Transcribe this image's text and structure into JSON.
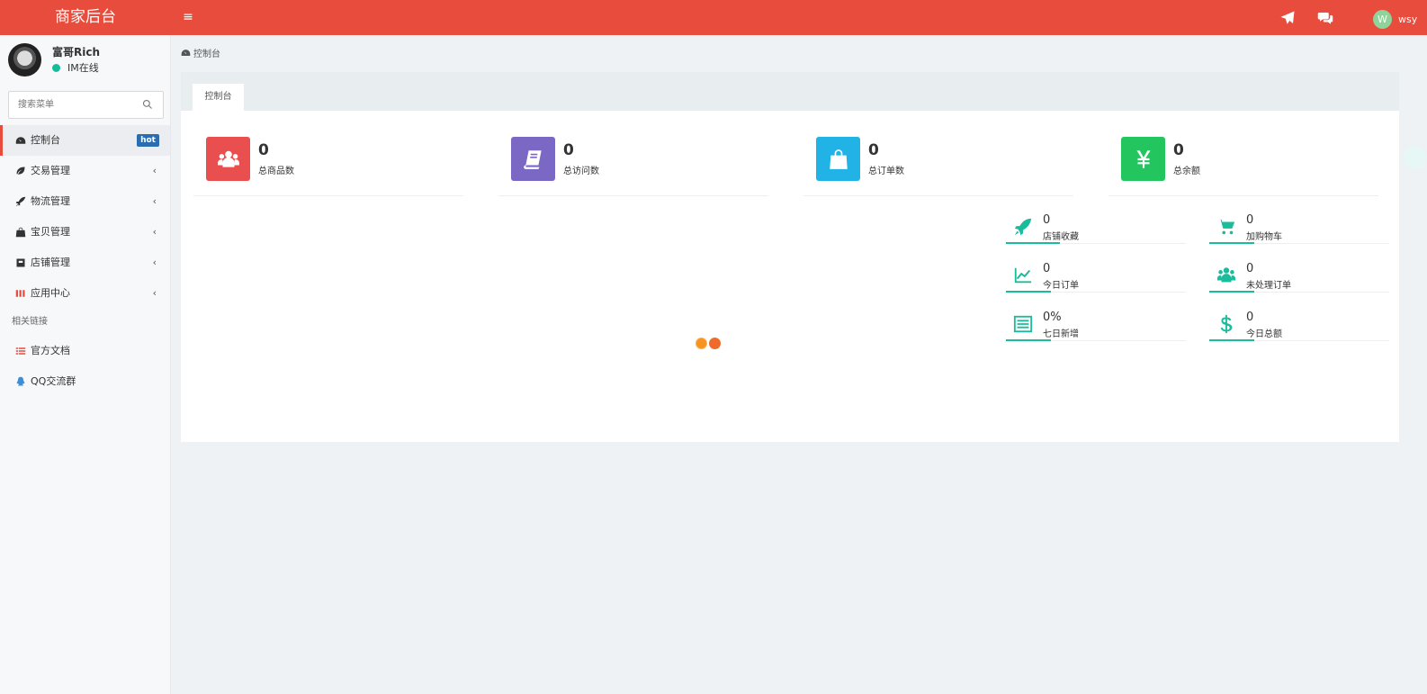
{
  "header": {
    "brand": "商家后台",
    "toggle_glyph": "≡",
    "user_initial": "W",
    "username": "wsy",
    "icons": [
      "paper-plane-icon",
      "comments-icon"
    ]
  },
  "sidebar": {
    "profile": {
      "name": "富哥Rich",
      "status": "IM在线"
    },
    "search": {
      "placeholder": "搜索菜单"
    },
    "items": [
      {
        "label": "控制台",
        "badge": "hot",
        "icon": "dashboard-icon"
      },
      {
        "label": "交易管理",
        "icon": "leaf-icon"
      },
      {
        "label": "物流管理",
        "icon": "rocket-icon"
      },
      {
        "label": "宝贝管理",
        "icon": "shopping-bag-icon"
      },
      {
        "label": "店铺管理",
        "icon": "store-square-icon"
      },
      {
        "label": "应用中心",
        "icon": "grid-icon"
      }
    ],
    "section_header": "相关链接",
    "links": [
      {
        "label": "官方文档",
        "icon": "list-icon"
      },
      {
        "label": "QQ交流群",
        "icon": "qq-icon"
      }
    ],
    "chevron": "‹"
  },
  "breadcrumb": {
    "label": "控制台"
  },
  "tabs": {
    "active": "控制台"
  },
  "stats": [
    {
      "value": "0",
      "label": "总商品数",
      "color": "#ea4f4f",
      "icon": "users-icon"
    },
    {
      "value": "0",
      "label": "总访问数",
      "color": "#7b68c4",
      "icon": "book-icon"
    },
    {
      "value": "0",
      "label": "总订单数",
      "color": "#22b3e6",
      "icon": "shopping-bag-icon"
    },
    {
      "value": "0",
      "label": "总余额",
      "color": "#22c55e",
      "icon": "yen-icon"
    }
  ],
  "mini_stats": [
    {
      "value": "0",
      "label": "店铺收藏",
      "icon": "rocket-icon"
    },
    {
      "value": "0",
      "label": "加购物车",
      "icon": "cart-icon"
    },
    {
      "value": "0",
      "label": "今日订单",
      "icon": "line-chart-icon"
    },
    {
      "value": "0",
      "label": "未处理订单",
      "icon": "users-icon"
    },
    {
      "value": "0%",
      "label": "七日新增",
      "icon": "list-alt-icon"
    },
    {
      "value": "0",
      "label": "今日总额",
      "icon": "dollar-icon"
    }
  ],
  "colors": {
    "topbar": "#e74c3c",
    "accent": "#1abc9c",
    "hot_badge": "#2c6db1"
  }
}
